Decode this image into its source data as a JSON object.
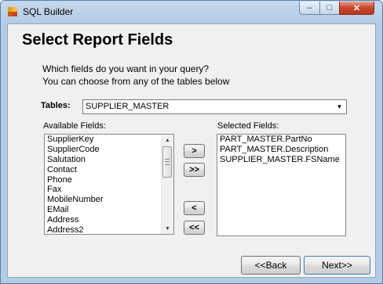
{
  "window": {
    "title": "SQL Builder",
    "controls": {
      "minimize": "–",
      "maximize": "□",
      "close": "✕"
    }
  },
  "page": {
    "heading": "Select Report Fields",
    "prompt_line1": "Which fields do you want in your query?",
    "prompt_line2": "You can choose from any of the tables below"
  },
  "tables": {
    "label": "Tables:",
    "selected": "SUPPLIER_MASTER"
  },
  "available": {
    "label": "Available Fields:",
    "items": [
      "SupplierKey",
      "SupplierCode",
      "Salutation",
      "Contact",
      "Phone",
      "Fax",
      "MobileNumber",
      "EMail",
      "Address",
      "Address2"
    ]
  },
  "selected": {
    "label": "Selected Fields:",
    "items": [
      "PART_MASTER.PartNo",
      "PART_MASTER.Description",
      "SUPPLIER_MASTER.FSName"
    ]
  },
  "buttons": {
    "add": ">",
    "add_all": ">>",
    "remove": "<",
    "remove_all": "<<",
    "back": "<<Back",
    "next": "Next>>"
  }
}
